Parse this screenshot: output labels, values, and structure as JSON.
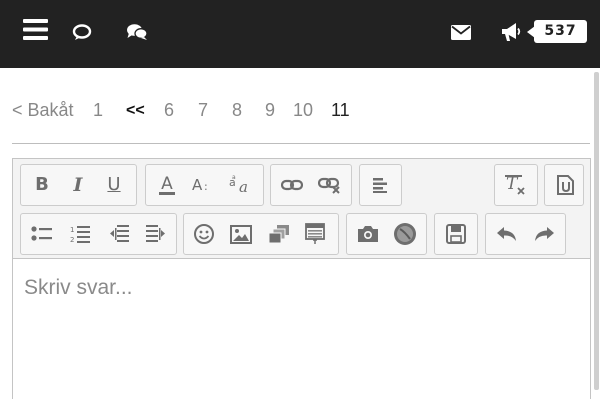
{
  "topbar": {
    "icons": [
      "menu-icon",
      "chat-bubble-outline-icon",
      "chat-bubbles-icon",
      "envelope-icon",
      "megaphone-icon"
    ],
    "notification_count": "537",
    "colors": {
      "background": "#222222",
      "icon": "#ffffff"
    }
  },
  "pagination": {
    "back_label": "< Bakåt",
    "first_page": "1",
    "jump_label": "<<",
    "pages": [
      "6",
      "7",
      "8",
      "9",
      "10"
    ],
    "current_page": "11"
  },
  "editor": {
    "placeholder": "Skriv svar...",
    "toolbar_row1": [
      "bold-icon",
      "italic-icon",
      "underline-icon",
      "text-color-icon",
      "font-size-icon",
      "font-family-icon",
      "link-icon",
      "unlink-icon",
      "align-left-icon",
      "remove-format-icon",
      "source-code-icon"
    ],
    "toolbar_row2": [
      "bulleted-list-icon",
      "numbered-list-icon",
      "outdent-icon",
      "indent-icon",
      "emoji-icon",
      "image-icon",
      "gallery-icon",
      "table-icon",
      "camera-icon",
      "media-icon",
      "save-icon",
      "undo-icon",
      "redo-icon"
    ]
  }
}
